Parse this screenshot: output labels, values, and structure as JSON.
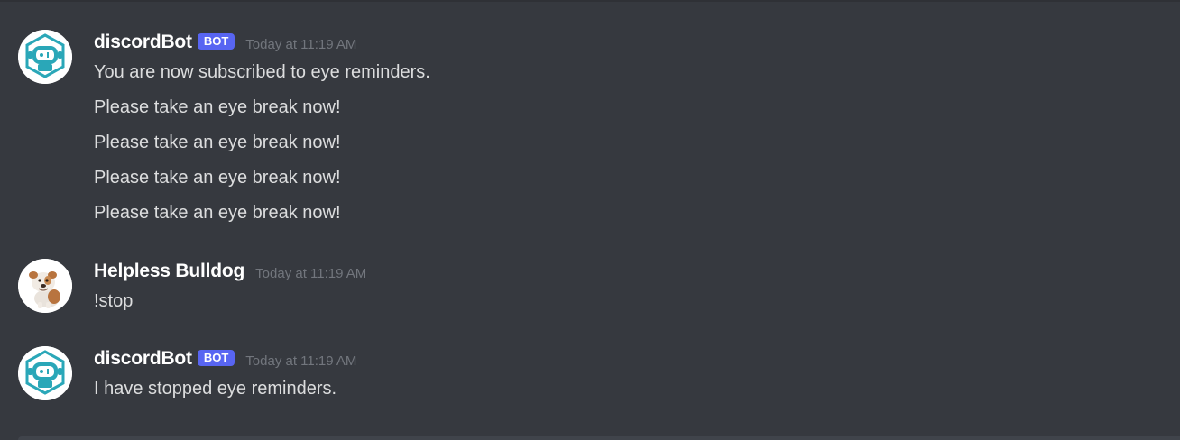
{
  "messages": [
    {
      "author": "discordBot",
      "bot_tag": "BOT",
      "timestamp": "Today at 11:19 AM",
      "avatar_icon": "robot-icon",
      "lines": [
        "You are now subscribed to eye reminders.",
        "Please take an eye break now!",
        "Please take an eye break now!",
        "Please take an eye break now!",
        "Please take an eye break now!"
      ]
    },
    {
      "author": "Helpless Bulldog",
      "timestamp": "Today at 11:19 AM",
      "avatar_icon": "bulldog-icon",
      "lines": [
        "!stop"
      ]
    },
    {
      "author": "discordBot",
      "bot_tag": "BOT",
      "timestamp": "Today at 11:19 AM",
      "avatar_icon": "robot-icon",
      "lines": [
        "I have stopped eye reminders."
      ]
    }
  ],
  "colors": {
    "background": "#36393f",
    "username": "#ffffff",
    "message_text": "#dcddde",
    "timestamp": "#72767d",
    "bot_tag": "#5865f2",
    "bot_avatar_accent": "#2aa7b8"
  }
}
